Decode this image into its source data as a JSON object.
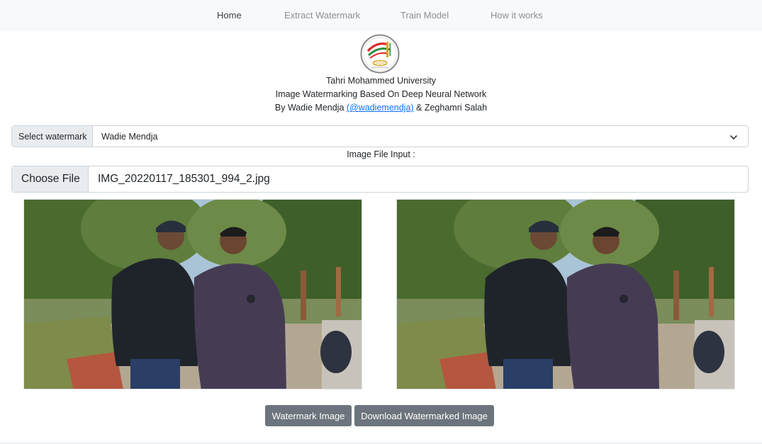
{
  "nav": {
    "items": [
      {
        "label": "Home",
        "active": true
      },
      {
        "label": "Extract Watermark",
        "active": false
      },
      {
        "label": "Train Model",
        "active": false
      },
      {
        "label": "How it works",
        "active": false
      }
    ]
  },
  "header": {
    "logo_icon": "university-logo-icon",
    "university": "Tahri Mohammed University",
    "project_title": "Image Watermarking Based On Deep Neural Network",
    "byline_prefix": "By Wadie Mendja ",
    "byline_link": "(@wadiemendja)",
    "byline_suffix": " & Zeghamri Salah"
  },
  "watermark_select": {
    "label": "Select watermark",
    "selected": "Wadie Mendja",
    "icon": "chevron-down-icon"
  },
  "file_input": {
    "caption": "Image File Input :",
    "button_label": "Choose File",
    "filename": "IMG_20220117_185301_994_2.jpg"
  },
  "images": {
    "original_icon": "photo-original",
    "watermarked_icon": "photo-watermarked"
  },
  "actions": {
    "watermark_label": "Watermark Image",
    "download_label": "Download Watermarked Image"
  },
  "colors": {
    "navbar_bg": "#f8f9fa",
    "link_blue": "#0d6efd",
    "button_gray": "#6c757d",
    "border": "#ced4da"
  }
}
